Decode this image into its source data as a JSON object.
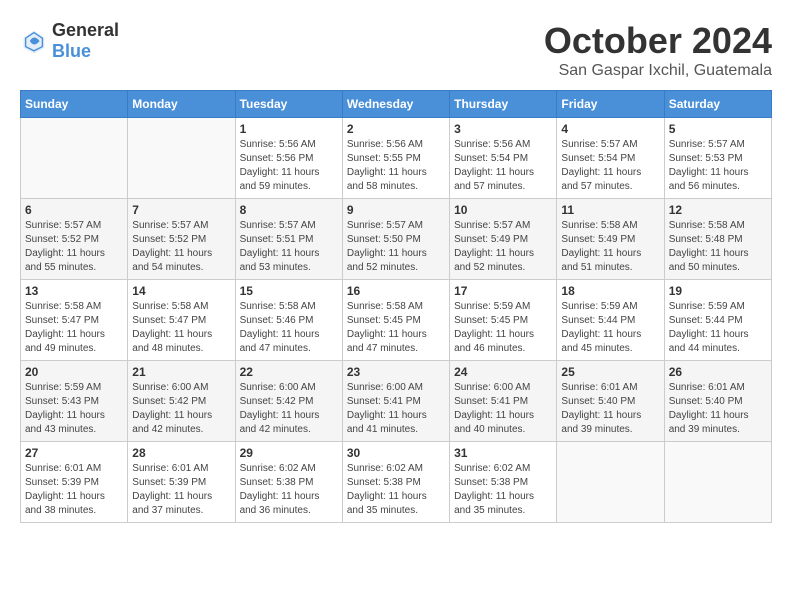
{
  "logo": {
    "general": "General",
    "blue": "Blue"
  },
  "header": {
    "month": "October 2024",
    "location": "San Gaspar Ixchil, Guatemala"
  },
  "weekdays": [
    "Sunday",
    "Monday",
    "Tuesday",
    "Wednesday",
    "Thursday",
    "Friday",
    "Saturday"
  ],
  "weeks": [
    [
      {
        "day": "",
        "sunrise": "",
        "sunset": "",
        "daylight": ""
      },
      {
        "day": "",
        "sunrise": "",
        "sunset": "",
        "daylight": ""
      },
      {
        "day": "1",
        "sunrise": "Sunrise: 5:56 AM",
        "sunset": "Sunset: 5:56 PM",
        "daylight": "Daylight: 11 hours and 59 minutes."
      },
      {
        "day": "2",
        "sunrise": "Sunrise: 5:56 AM",
        "sunset": "Sunset: 5:55 PM",
        "daylight": "Daylight: 11 hours and 58 minutes."
      },
      {
        "day": "3",
        "sunrise": "Sunrise: 5:56 AM",
        "sunset": "Sunset: 5:54 PM",
        "daylight": "Daylight: 11 hours and 57 minutes."
      },
      {
        "day": "4",
        "sunrise": "Sunrise: 5:57 AM",
        "sunset": "Sunset: 5:54 PM",
        "daylight": "Daylight: 11 hours and 57 minutes."
      },
      {
        "day": "5",
        "sunrise": "Sunrise: 5:57 AM",
        "sunset": "Sunset: 5:53 PM",
        "daylight": "Daylight: 11 hours and 56 minutes."
      }
    ],
    [
      {
        "day": "6",
        "sunrise": "Sunrise: 5:57 AM",
        "sunset": "Sunset: 5:52 PM",
        "daylight": "Daylight: 11 hours and 55 minutes."
      },
      {
        "day": "7",
        "sunrise": "Sunrise: 5:57 AM",
        "sunset": "Sunset: 5:52 PM",
        "daylight": "Daylight: 11 hours and 54 minutes."
      },
      {
        "day": "8",
        "sunrise": "Sunrise: 5:57 AM",
        "sunset": "Sunset: 5:51 PM",
        "daylight": "Daylight: 11 hours and 53 minutes."
      },
      {
        "day": "9",
        "sunrise": "Sunrise: 5:57 AM",
        "sunset": "Sunset: 5:50 PM",
        "daylight": "Daylight: 11 hours and 52 minutes."
      },
      {
        "day": "10",
        "sunrise": "Sunrise: 5:57 AM",
        "sunset": "Sunset: 5:49 PM",
        "daylight": "Daylight: 11 hours and 52 minutes."
      },
      {
        "day": "11",
        "sunrise": "Sunrise: 5:58 AM",
        "sunset": "Sunset: 5:49 PM",
        "daylight": "Daylight: 11 hours and 51 minutes."
      },
      {
        "day": "12",
        "sunrise": "Sunrise: 5:58 AM",
        "sunset": "Sunset: 5:48 PM",
        "daylight": "Daylight: 11 hours and 50 minutes."
      }
    ],
    [
      {
        "day": "13",
        "sunrise": "Sunrise: 5:58 AM",
        "sunset": "Sunset: 5:47 PM",
        "daylight": "Daylight: 11 hours and 49 minutes."
      },
      {
        "day": "14",
        "sunrise": "Sunrise: 5:58 AM",
        "sunset": "Sunset: 5:47 PM",
        "daylight": "Daylight: 11 hours and 48 minutes."
      },
      {
        "day": "15",
        "sunrise": "Sunrise: 5:58 AM",
        "sunset": "Sunset: 5:46 PM",
        "daylight": "Daylight: 11 hours and 47 minutes."
      },
      {
        "day": "16",
        "sunrise": "Sunrise: 5:58 AM",
        "sunset": "Sunset: 5:45 PM",
        "daylight": "Daylight: 11 hours and 47 minutes."
      },
      {
        "day": "17",
        "sunrise": "Sunrise: 5:59 AM",
        "sunset": "Sunset: 5:45 PM",
        "daylight": "Daylight: 11 hours and 46 minutes."
      },
      {
        "day": "18",
        "sunrise": "Sunrise: 5:59 AM",
        "sunset": "Sunset: 5:44 PM",
        "daylight": "Daylight: 11 hours and 45 minutes."
      },
      {
        "day": "19",
        "sunrise": "Sunrise: 5:59 AM",
        "sunset": "Sunset: 5:44 PM",
        "daylight": "Daylight: 11 hours and 44 minutes."
      }
    ],
    [
      {
        "day": "20",
        "sunrise": "Sunrise: 5:59 AM",
        "sunset": "Sunset: 5:43 PM",
        "daylight": "Daylight: 11 hours and 43 minutes."
      },
      {
        "day": "21",
        "sunrise": "Sunrise: 6:00 AM",
        "sunset": "Sunset: 5:42 PM",
        "daylight": "Daylight: 11 hours and 42 minutes."
      },
      {
        "day": "22",
        "sunrise": "Sunrise: 6:00 AM",
        "sunset": "Sunset: 5:42 PM",
        "daylight": "Daylight: 11 hours and 42 minutes."
      },
      {
        "day": "23",
        "sunrise": "Sunrise: 6:00 AM",
        "sunset": "Sunset: 5:41 PM",
        "daylight": "Daylight: 11 hours and 41 minutes."
      },
      {
        "day": "24",
        "sunrise": "Sunrise: 6:00 AM",
        "sunset": "Sunset: 5:41 PM",
        "daylight": "Daylight: 11 hours and 40 minutes."
      },
      {
        "day": "25",
        "sunrise": "Sunrise: 6:01 AM",
        "sunset": "Sunset: 5:40 PM",
        "daylight": "Daylight: 11 hours and 39 minutes."
      },
      {
        "day": "26",
        "sunrise": "Sunrise: 6:01 AM",
        "sunset": "Sunset: 5:40 PM",
        "daylight": "Daylight: 11 hours and 39 minutes."
      }
    ],
    [
      {
        "day": "27",
        "sunrise": "Sunrise: 6:01 AM",
        "sunset": "Sunset: 5:39 PM",
        "daylight": "Daylight: 11 hours and 38 minutes."
      },
      {
        "day": "28",
        "sunrise": "Sunrise: 6:01 AM",
        "sunset": "Sunset: 5:39 PM",
        "daylight": "Daylight: 11 hours and 37 minutes."
      },
      {
        "day": "29",
        "sunrise": "Sunrise: 6:02 AM",
        "sunset": "Sunset: 5:38 PM",
        "daylight": "Daylight: 11 hours and 36 minutes."
      },
      {
        "day": "30",
        "sunrise": "Sunrise: 6:02 AM",
        "sunset": "Sunset: 5:38 PM",
        "daylight": "Daylight: 11 hours and 35 minutes."
      },
      {
        "day": "31",
        "sunrise": "Sunrise: 6:02 AM",
        "sunset": "Sunset: 5:38 PM",
        "daylight": "Daylight: 11 hours and 35 minutes."
      },
      {
        "day": "",
        "sunrise": "",
        "sunset": "",
        "daylight": ""
      },
      {
        "day": "",
        "sunrise": "",
        "sunset": "",
        "daylight": ""
      }
    ]
  ]
}
